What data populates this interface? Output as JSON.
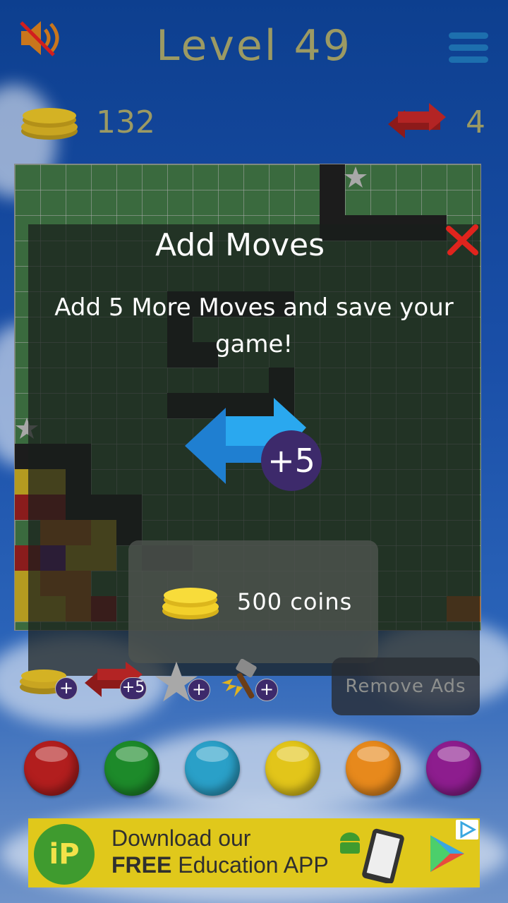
{
  "header": {
    "level_title": "Level 49",
    "coins": "132",
    "moves": "4"
  },
  "dialog": {
    "title": "Add Moves",
    "text": "Add 5 More Moves and save your game!",
    "badge": "+5",
    "price_label": "500 coins"
  },
  "powerups": {
    "moves_badge": "+5",
    "plus": "+"
  },
  "remove_ads_label": "Remove Ads",
  "colors": {
    "title_text": "#9c9a63",
    "badge_bg": "#3d2a6b",
    "close_red": "#e0241d",
    "balls": [
      "#b21e1e",
      "#1d8a2a",
      "#2aa0c8",
      "#e2c51a",
      "#e7891c",
      "#8d1d8e"
    ]
  },
  "color_buttons": [
    "red",
    "green",
    "cyan",
    "yellow",
    "orange",
    "purple"
  ],
  "ad": {
    "logo_text": "iP",
    "line1": "Download our",
    "line2_bold": "FREE",
    "line2_rest": " Education APP"
  },
  "icons": {
    "sound": "speaker-muted-icon",
    "menu": "hamburger-menu-icon",
    "coins": "coin-stack-icon",
    "moves": "swap-arrows-icon",
    "close": "close-x-icon",
    "star": "star-icon",
    "hammer": "hammer-icon",
    "android": "android-icon",
    "play_store": "play-store-icon"
  }
}
